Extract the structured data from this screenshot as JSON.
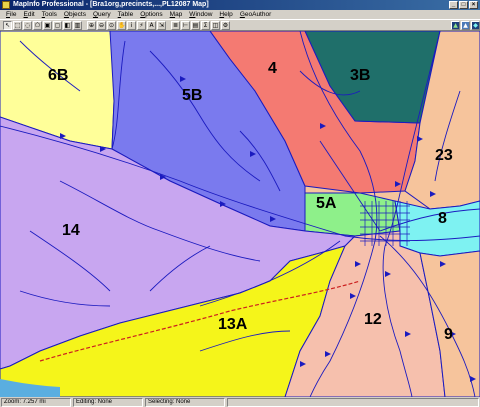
{
  "window": {
    "title": "MapInfo Professional - [Bra1org,precincts,...,PL12087 Map]",
    "controls": {
      "minimize": "_",
      "maximize": "□",
      "close": "×"
    }
  },
  "menubar": {
    "items": [
      {
        "accel": "F",
        "rest": "ile"
      },
      {
        "accel": "E",
        "rest": "dit"
      },
      {
        "accel": "T",
        "rest": "ools"
      },
      {
        "accel": "O",
        "rest": "bjects"
      },
      {
        "accel": "Q",
        "rest": "uery"
      },
      {
        "accel": "T",
        "rest": "able"
      },
      {
        "accel": "O",
        "rest": "ptions"
      },
      {
        "accel": "M",
        "rest": "ap"
      },
      {
        "accel": "W",
        "rest": "indow"
      },
      {
        "accel": "H",
        "rest": "elp"
      },
      {
        "accel": "G",
        "rest": "eoAuthor"
      }
    ]
  },
  "toolbar": {
    "buttons": [
      {
        "icon": "select-arrow-icon",
        "glyph": "↖"
      },
      {
        "icon": "marquee-select-icon",
        "glyph": "⬚"
      },
      {
        "icon": "radius-select-icon",
        "glyph": "◌"
      },
      {
        "icon": "polygon-select-icon",
        "glyph": "⬠"
      },
      {
        "icon": "boundary-select-icon",
        "glyph": "▣"
      },
      {
        "icon": "unselect-icon",
        "glyph": "▢"
      },
      {
        "icon": "invert-select-icon",
        "glyph": "◧"
      },
      {
        "icon": "graph-select-icon",
        "glyph": "▥"
      },
      {
        "icon": "zoom-in-icon",
        "glyph": "⊕"
      },
      {
        "icon": "zoom-out-icon",
        "glyph": "⊖"
      },
      {
        "icon": "change-view-icon",
        "glyph": "⊙"
      },
      {
        "icon": "grabber-icon",
        "glyph": "✋"
      },
      {
        "icon": "info-icon",
        "glyph": "i"
      },
      {
        "icon": "hotlink-icon",
        "glyph": "⚡"
      },
      {
        "icon": "label-icon",
        "glyph": "A"
      },
      {
        "icon": "drag-window-icon",
        "glyph": "⇲"
      },
      {
        "icon": "layer-control-icon",
        "glyph": "≣"
      },
      {
        "icon": "ruler-icon",
        "glyph": "⊢"
      },
      {
        "icon": "legend-icon",
        "glyph": "▤"
      },
      {
        "icon": "statistics-icon",
        "glyph": "Σ"
      },
      {
        "icon": "clip-region-icon",
        "glyph": "◫"
      },
      {
        "icon": "setup-icon",
        "glyph": "⚙"
      }
    ],
    "right_buttons": [
      {
        "icon": "layer-tool-icon-1",
        "glyph": "▲"
      },
      {
        "icon": "layer-tool-icon-2",
        "glyph": "▲"
      },
      {
        "icon": "layer-tool-icon-3",
        "glyph": "◆"
      }
    ]
  },
  "map": {
    "precincts": [
      {
        "id": "6B",
        "color": "#ffff99"
      },
      {
        "id": "5B",
        "color": "#7a7aee"
      },
      {
        "id": "4",
        "color": "#f47a72"
      },
      {
        "id": "3B",
        "color": "#1f6f6a"
      },
      {
        "id": "23",
        "color": "#f6c49c"
      },
      {
        "id": "5A",
        "color": "#8ef08a"
      },
      {
        "id": "8",
        "color": "#7ef2f2"
      },
      {
        "id": "14",
        "color": "#c8a6f0"
      },
      {
        "id": "13A",
        "color": "#f5f51a"
      },
      {
        "id": "12",
        "color": "#f6c0ad"
      },
      {
        "id": "9",
        "color": "#f6c49c"
      }
    ],
    "colors": {
      "road_line": "#1b1bbf",
      "highway_line": "#cc1f1f",
      "water": "#5aaee0"
    }
  },
  "status": {
    "zoom": "Zoom: 7.257 mi",
    "editing": "Editing: None",
    "selecting": "Selecting: None"
  }
}
